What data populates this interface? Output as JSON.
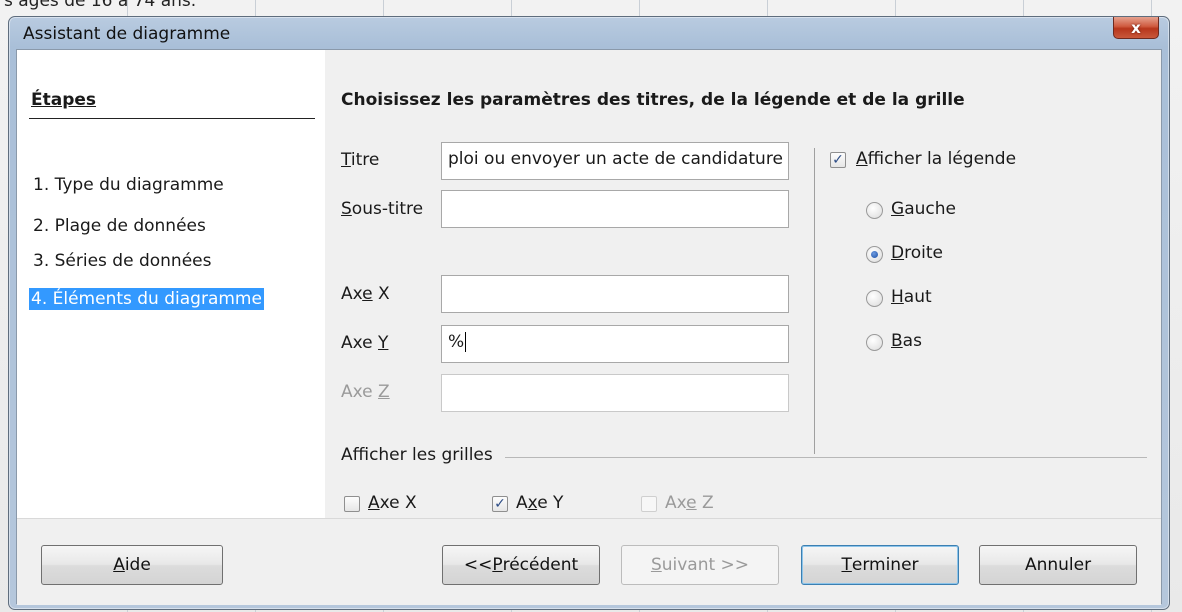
{
  "background": {
    "text": "s âgés de 16 à 74 ans."
  },
  "window": {
    "title": "Assistant de diagramme",
    "close_glyph": "x"
  },
  "steps": {
    "heading": "Étapes",
    "items": [
      {
        "label": "1. Type du diagramme",
        "active": false
      },
      {
        "label": "2. Plage de données",
        "active": false
      },
      {
        "label": "3. Séries de données",
        "active": false
      },
      {
        "label": "4. Éléments du diagramme",
        "active": true
      }
    ]
  },
  "panel": {
    "heading": "Choisissez les paramètres des titres, de la légende et de la grille",
    "fields": {
      "title": {
        "label_accel": "T",
        "label_rest": "itre",
        "value": "ploi ou envoyer un acte de candidature"
      },
      "subtitle": {
        "label_accel": "S",
        "label_rest": "ous-titre",
        "value": ""
      },
      "axis_x": {
        "label_pre": "Ax",
        "label_accel": "e",
        "label_rest": " X",
        "value": ""
      },
      "axis_y": {
        "label_pre": "Axe ",
        "label_accel": "Y",
        "label_rest": "",
        "value": "%"
      },
      "axis_z": {
        "label_pre": "Axe ",
        "label_accel": "Z",
        "label_rest": "",
        "value": "",
        "disabled": true
      }
    },
    "legend": {
      "show_accel": "A",
      "show_rest": "fficher la légende",
      "show_checked": true,
      "options": [
        {
          "accel": "G",
          "rest": "auche",
          "selected": false
        },
        {
          "accel": "D",
          "rest": "roite",
          "selected": true
        },
        {
          "accel": "H",
          "rest": "aut",
          "selected": false
        },
        {
          "accel": "B",
          "rest": "as",
          "selected": false
        }
      ]
    },
    "grids": {
      "title": "Afficher les grilles",
      "x": {
        "accel": "A",
        "rest": "xe X",
        "checked": false
      },
      "y": {
        "pre": "A",
        "accel": "x",
        "rest": "e Y",
        "checked": true
      },
      "z": {
        "pre": "Ax",
        "accel": "e",
        "rest": " Z",
        "checked": false,
        "disabled": true
      }
    }
  },
  "buttons": {
    "help": {
      "accel": "A",
      "rest": "ide"
    },
    "previous": {
      "pre": "<< ",
      "accel": "P",
      "rest": "récédent"
    },
    "next": {
      "accel": "S",
      "rest": "uivant >>",
      "disabled": true
    },
    "finish": {
      "accel": "T",
      "rest": "erminer",
      "default": true
    },
    "cancel": {
      "label": "Annuler"
    }
  }
}
